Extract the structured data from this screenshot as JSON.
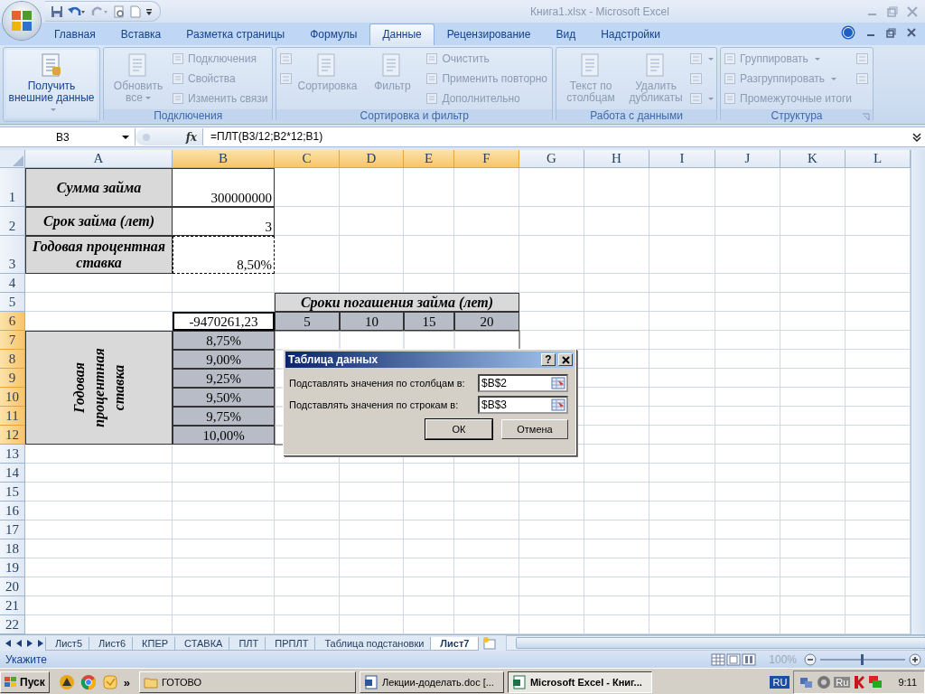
{
  "window": {
    "title": "Книга1.xlsx - Microsoft Excel"
  },
  "ribbon_tabs": [
    {
      "label": "Главная",
      "selected": false
    },
    {
      "label": "Вставка",
      "selected": false
    },
    {
      "label": "Разметка страницы",
      "selected": false
    },
    {
      "label": "Формулы",
      "selected": false
    },
    {
      "label": "Данные",
      "selected": true
    },
    {
      "label": "Рецензирование",
      "selected": false
    },
    {
      "label": "Вид",
      "selected": false
    },
    {
      "label": "Надстройки",
      "selected": false
    }
  ],
  "ribbon_groups": [
    {
      "items": [
        {
          "kind": "large",
          "label": "Получить внешние данные",
          "disabled": false,
          "menu": true
        }
      ]
    },
    {
      "title": "Подключения",
      "items": [
        {
          "kind": "large",
          "label": "Обновить все",
          "disabled": true,
          "menu": true
        },
        {
          "kind": "small",
          "label": "Подключения",
          "disabled": true,
          "menu": false
        },
        {
          "kind": "small",
          "label": "Свойства",
          "disabled": true,
          "menu": false
        },
        {
          "kind": "small",
          "label": "Изменить связи",
          "disabled": true,
          "menu": false
        }
      ]
    },
    {
      "title": "Сортировка и фильтр",
      "items": [
        {
          "kind": "icon",
          "disabled": true,
          "menu": false
        },
        {
          "kind": "icon",
          "disabled": true,
          "menu": false
        },
        {
          "kind": "large",
          "label": "Сортировка",
          "disabled": true,
          "menu": false
        },
        {
          "kind": "large",
          "label": "Фильтр",
          "disabled": true,
          "menu": false
        },
        {
          "kind": "small",
          "label": "Очистить",
          "disabled": true,
          "menu": false
        },
        {
          "kind": "small",
          "label": "Применить повторно",
          "disabled": true,
          "menu": false
        },
        {
          "kind": "small",
          "label": "Дополнительно",
          "disabled": true,
          "menu": false
        }
      ]
    },
    {
      "title": "Работа с данными",
      "items": [
        {
          "kind": "large",
          "label": "Текст по столбцам",
          "disabled": true,
          "menu": false
        },
        {
          "kind": "large",
          "label": "Удалить дубликаты",
          "disabled": true,
          "menu": false
        },
        {
          "kind": "icon",
          "disabled": true,
          "menu": true
        },
        {
          "kind": "icon",
          "disabled": true,
          "menu": false
        },
        {
          "kind": "icon",
          "disabled": true,
          "menu": true
        }
      ]
    },
    {
      "title": "Структура",
      "launcher": true,
      "items": [
        {
          "kind": "small",
          "label": "Группировать",
          "disabled": true,
          "menu": true
        },
        {
          "kind": "small",
          "label": "Разгруппировать",
          "disabled": true,
          "menu": true
        },
        {
          "kind": "small",
          "label": "Промежуточные итоги",
          "disabled": true,
          "menu": false
        },
        {
          "kind": "icon",
          "disabled": true,
          "menu": false
        },
        {
          "kind": "icon",
          "disabled": true,
          "menu": false
        }
      ]
    }
  ],
  "formula_bar": {
    "name_box": "B3",
    "function_label": "fx",
    "formula": "=ПЛТ(B3/12;B2*12;B1)"
  },
  "sheet": {
    "columns": [
      {
        "label": "A",
        "highlighted": false
      },
      {
        "label": "B",
        "highlighted": true
      },
      {
        "label": "C",
        "highlighted": true
      },
      {
        "label": "D",
        "highlighted": true
      },
      {
        "label": "E",
        "highlighted": true
      },
      {
        "label": "F",
        "highlighted": true
      },
      {
        "label": "G",
        "highlighted": false
      },
      {
        "label": "H",
        "highlighted": false
      },
      {
        "label": "I",
        "highlighted": false
      },
      {
        "label": "J",
        "highlighted": false
      },
      {
        "label": "K",
        "highlighted": false
      },
      {
        "label": "L",
        "highlighted": false
      }
    ],
    "rows": [
      {
        "label": "1",
        "highlighted": false,
        "cells": [
          {
            "kind": "label",
            "text": "Сумма займа"
          },
          {
            "kind": "value",
            "text": "300000000"
          }
        ]
      },
      {
        "label": "2",
        "highlighted": false,
        "cells": [
          {
            "kind": "label",
            "text": "Срок займа (лет)"
          },
          {
            "kind": "value",
            "text": "3"
          }
        ]
      },
      {
        "label": "3",
        "highlighted": false,
        "cells": [
          {
            "kind": "label",
            "text": "Годовая процентная ставка"
          },
          {
            "kind": "copied",
            "text": "8,50%"
          }
        ]
      },
      {
        "label": "4",
        "highlighted": false,
        "cells": []
      },
      {
        "label": "5",
        "highlighted": false,
        "cells": [
          {
            "kind": "none"
          },
          {
            "kind": "none"
          },
          {
            "kind": "span-header",
            "text": "Сроки погашения займа (лет)"
          }
        ]
      },
      {
        "label": "6",
        "highlighted": true,
        "cells": [
          {
            "kind": "none"
          },
          {
            "kind": "result",
            "text": "-9470261,23"
          },
          {
            "kind": "term",
            "text": "5"
          },
          {
            "kind": "term",
            "text": "10"
          },
          {
            "kind": "term",
            "text": "15"
          },
          {
            "kind": "term",
            "text": "20"
          }
        ]
      },
      {
        "label": "7",
        "highlighted": true,
        "cells": [
          {
            "kind": "merged"
          },
          {
            "kind": "rate",
            "text": "8,75%"
          }
        ]
      },
      {
        "label": "8",
        "highlighted": true,
        "cells": [
          {
            "kind": "merged"
          },
          {
            "kind": "rate",
            "text": "9,00%"
          }
        ]
      },
      {
        "label": "9",
        "highlighted": true,
        "cells": [
          {
            "kind": "merged"
          },
          {
            "kind": "rate",
            "text": "9,25%"
          }
        ]
      },
      {
        "label": "10",
        "highlighted": true,
        "cells": [
          {
            "kind": "merged"
          },
          {
            "kind": "rate",
            "text": "9,50%"
          }
        ]
      },
      {
        "label": "11",
        "highlighted": true,
        "cells": [
          {
            "kind": "merged"
          },
          {
            "kind": "rate",
            "text": "9,75%"
          }
        ]
      },
      {
        "label": "12",
        "highlighted": true,
        "cells": [
          {
            "kind": "merged"
          },
          {
            "kind": "rate",
            "text": "10,00%"
          }
        ]
      },
      {
        "label": "13",
        "highlighted": false,
        "cells": []
      },
      {
        "label": "14",
        "highlighted": false,
        "cells": []
      },
      {
        "label": "15",
        "highlighted": false,
        "cells": []
      },
      {
        "label": "16",
        "highlighted": false,
        "cells": []
      },
      {
        "label": "17",
        "highlighted": false,
        "cells": []
      },
      {
        "label": "18",
        "highlighted": false,
        "cells": []
      },
      {
        "label": "19",
        "highlighted": false,
        "cells": []
      },
      {
        "label": "20",
        "highlighted": false,
        "cells": []
      },
      {
        "label": "21",
        "highlighted": false,
        "cells": []
      },
      {
        "label": "22",
        "highlighted": false,
        "cells": []
      }
    ],
    "merged_label": {
      "text": "Годовая процентная ставка"
    }
  },
  "dialog": {
    "title": "Таблица данных",
    "help": "?",
    "fields": [
      {
        "label": "Подставлять значения по столбцам в:",
        "value": "$B$2"
      },
      {
        "label": "Подставлять значения по строкам в:",
        "value": "$B$3"
      }
    ],
    "buttons": [
      "ОК",
      "Отмена"
    ]
  },
  "sheet_tabs": [
    {
      "label": "Лист5",
      "selected": false
    },
    {
      "label": "Лист6",
      "selected": false
    },
    {
      "label": "КПЕР",
      "selected": false
    },
    {
      "label": "СТАВКА",
      "selected": false
    },
    {
      "label": "ПЛТ",
      "selected": false
    },
    {
      "label": "ПРПЛТ",
      "selected": false
    },
    {
      "label": "Таблица подстановки",
      "selected": false
    },
    {
      "label": "Лист7",
      "selected": true
    }
  ],
  "status_bar": {
    "text": "Укажите",
    "zoom": "100%",
    "zoom_slider": {
      "level": 0.5
    }
  },
  "taskbar": {
    "start": "Пуск",
    "overflow": "»",
    "tasks": [
      {
        "label": "ГОТОВО",
        "kind": "folder",
        "selected": false
      },
      {
        "label": "Лекции-доделать.doc [...",
        "kind": "document",
        "selected": false
      },
      {
        "label": "Microsoft Excel - Книг...",
        "kind": "spreadsheet",
        "selected": true
      }
    ],
    "language": "RU",
    "input": "Ru",
    "time": "9:11"
  }
}
